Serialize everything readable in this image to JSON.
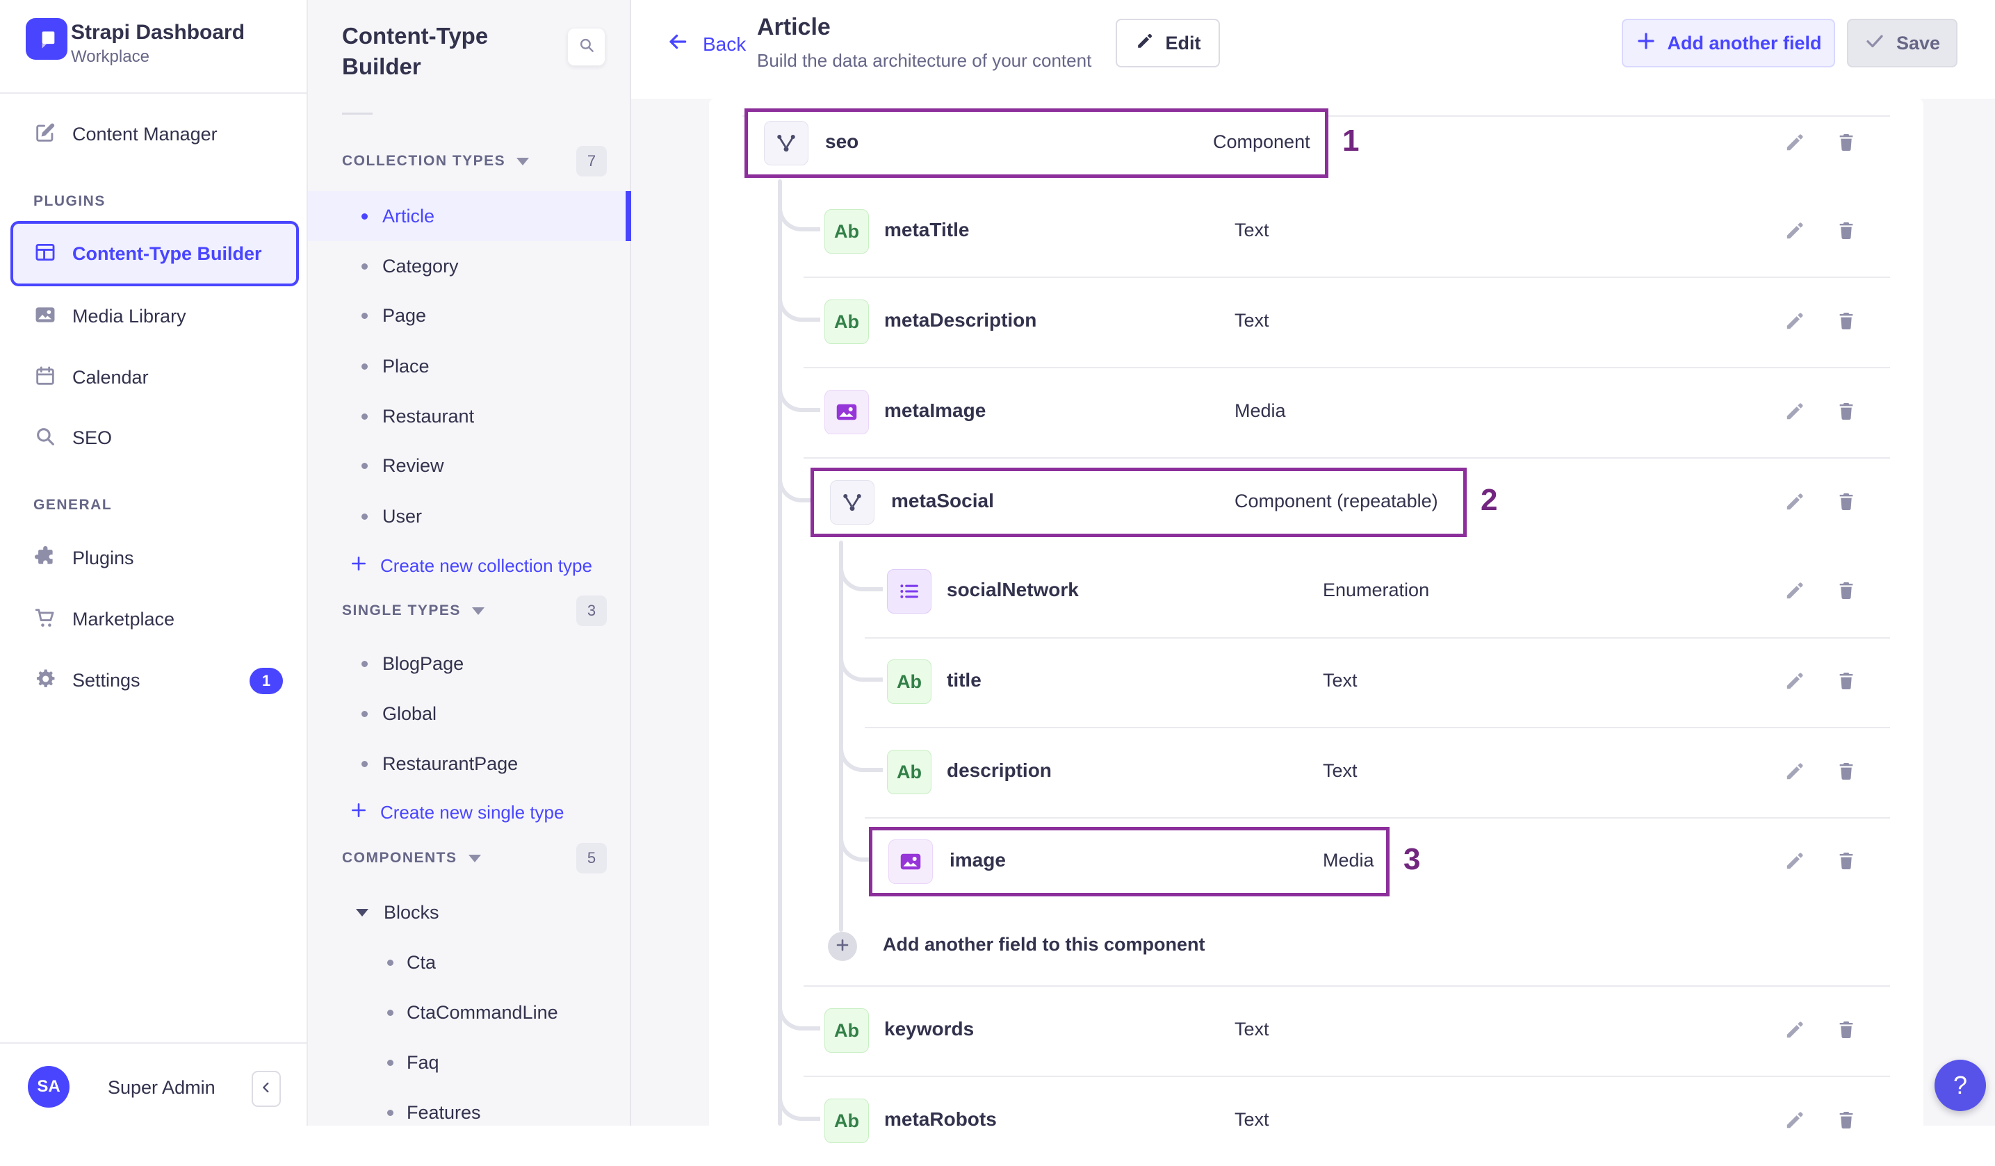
{
  "brand": {
    "name": "Strapi Dashboard",
    "workspace": "Workplace"
  },
  "left_nav": {
    "content_manager": "Content Manager",
    "plugins_header": "PLUGINS",
    "content_type_builder": "Content-Type Builder",
    "media_library": "Media Library",
    "calendar": "Calendar",
    "seo": "SEO",
    "general_header": "GENERAL",
    "plugins": "Plugins",
    "marketplace": "Marketplace",
    "settings": "Settings",
    "settings_badge": "1",
    "user_initials": "SA",
    "user_name": "Super Admin"
  },
  "subnav": {
    "title": "Content-Type Builder",
    "collection_header": "COLLECTION TYPES",
    "collection_badge": "7",
    "collection_items": [
      "Article",
      "Category",
      "Page",
      "Place",
      "Restaurant",
      "Review",
      "User"
    ],
    "collection_action": "Create new collection type",
    "single_header": "SINGLE TYPES",
    "single_badge": "3",
    "single_items": [
      "BlogPage",
      "Global",
      "RestaurantPage"
    ],
    "single_action": "Create new single type",
    "components_header": "COMPONENTS",
    "components_badge": "5",
    "components_group": "Blocks",
    "components_items": [
      "Cta",
      "CtaCommandLine",
      "Faq",
      "Features"
    ]
  },
  "header": {
    "back": "Back",
    "title": "Article",
    "subtitle": "Build the data architecture of your content",
    "edit": "Edit",
    "add_field": "Add another field",
    "save": "Save"
  },
  "fields": {
    "ab_label": "Ab",
    "rows": [
      {
        "name": "seo",
        "type": "Component",
        "annotation": "1"
      },
      {
        "name": "metaTitle",
        "type": "Text"
      },
      {
        "name": "metaDescription",
        "type": "Text"
      },
      {
        "name": "metaImage",
        "type": "Media"
      },
      {
        "name": "metaSocial",
        "type": "Component (repeatable)",
        "annotation": "2"
      },
      {
        "name": "socialNetwork",
        "type": "Enumeration"
      },
      {
        "name": "title",
        "type": "Text"
      },
      {
        "name": "description",
        "type": "Text"
      },
      {
        "name": "image",
        "type": "Media",
        "annotation": "3"
      },
      {
        "name": "keywords",
        "type": "Text"
      },
      {
        "name": "metaRobots",
        "type": "Text"
      }
    ],
    "add_more": "Add another field to this component"
  },
  "help": {
    "label": "?"
  },
  "colors": {
    "primary": "#4945ff",
    "highlight_border": "#8c2f9b",
    "annotation": "#72267f",
    "active_bg": "#f0f0ff"
  }
}
